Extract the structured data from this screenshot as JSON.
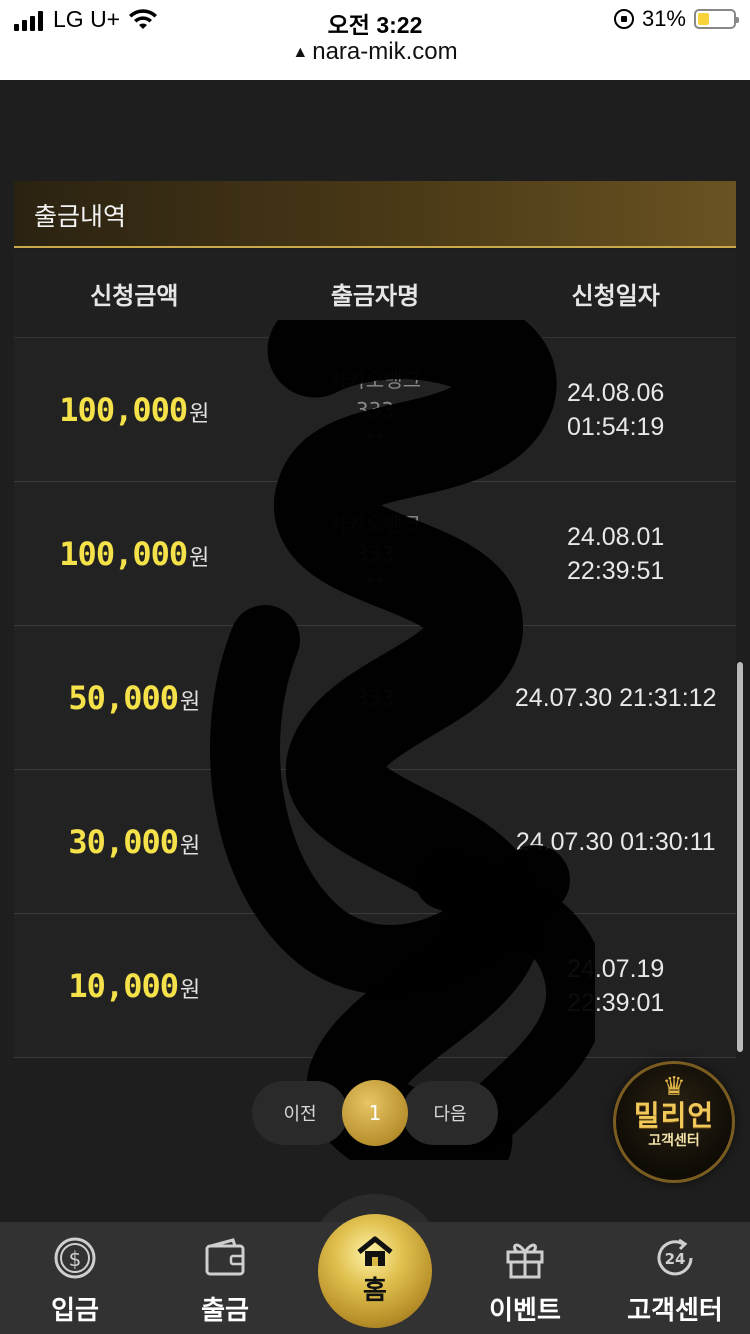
{
  "status_bar": {
    "carrier": "LG U+",
    "time": "오전 3:22",
    "battery": "31%",
    "battery_level": 0.31,
    "url": "nara-mik.com"
  },
  "panel": {
    "title": "출금내역"
  },
  "table": {
    "headers": [
      "신청금액",
      "출금자명",
      "신청일자"
    ],
    "currency_unit": "원",
    "rows": [
      {
        "amount": "100,000",
        "name_line1": "카카오뱅크",
        "name_line2": "333",
        "name_line3": "**",
        "date_line1": "24.08.06",
        "date_line2": "01:54:19"
      },
      {
        "amount": "100,000",
        "name_line1": "카카오뱅크",
        "name_line2": "333",
        "name_line3": "**",
        "date_line1": "24.08.01",
        "date_line2": "22:39:51"
      },
      {
        "amount": "50,000",
        "name_line1": "",
        "name_line2": "333",
        "name_line3": "",
        "date_line1": "24.07.30 21:31:12",
        "date_line2": ""
      },
      {
        "amount": "30,000",
        "name_line1": "",
        "name_line2": "",
        "name_line3": "",
        "date_line1": "24.07.30 01:30:11",
        "date_line2": ""
      },
      {
        "amount": "10,000",
        "name_line1": "",
        "name_line2": "",
        "name_line3": "",
        "date_line1": "24.07.19",
        "date_line2": "22:39:01"
      }
    ]
  },
  "pagination": {
    "prev": "이전",
    "current": "1",
    "next": "다음"
  },
  "cs_badge": {
    "brand": "밀리언",
    "sub": "고객센터"
  },
  "nav": {
    "deposit": "입금",
    "withdraw": "출금",
    "home": "홈",
    "event": "이벤트",
    "support": "고객센터",
    "support_icon_text": "24"
  },
  "colors": {
    "amount": "#f5e24a",
    "gold": "#c9a94a",
    "background": "#1e1e1e"
  }
}
